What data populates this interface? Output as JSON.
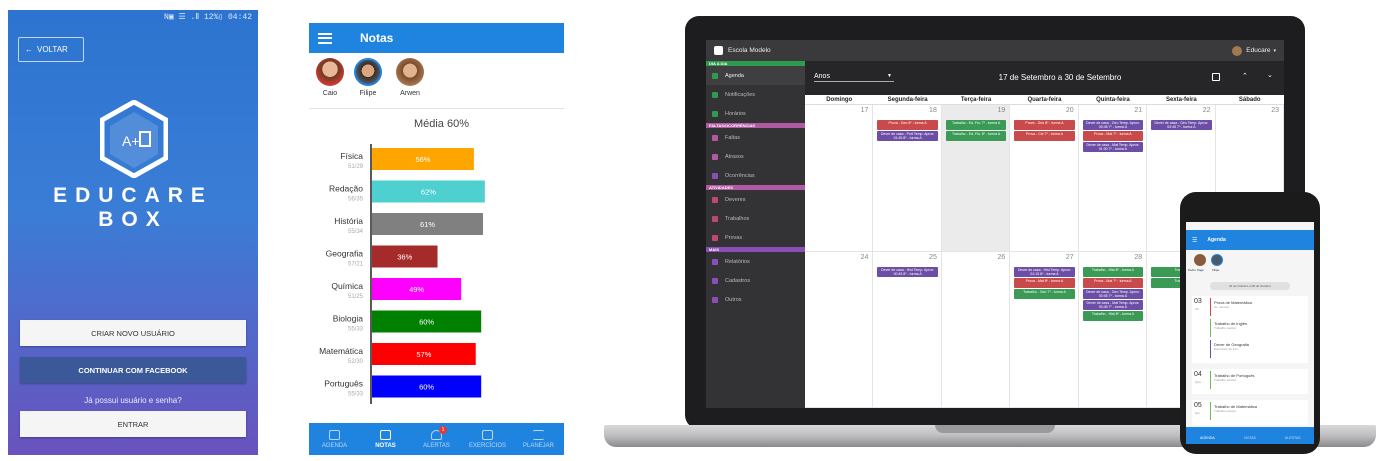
{
  "login": {
    "status": "N▣ ☰ .Ⅱ 12%▯ 04:42",
    "back_label": "VOLTAR",
    "brand_line1": "EDUCARE",
    "brand_line2": "BOX",
    "create_user": "CRIAR NOVO USUÁRIO",
    "facebook": "CONTINUAR COM FACEBOOK",
    "question": "Já possui usuário e senha?",
    "enter": "ENTRAR",
    "colors": {
      "facebook": "#3b5998"
    }
  },
  "grades": {
    "title": "Notas",
    "students": [
      "Caio",
      "Filipe",
      "Arwen"
    ],
    "average": "Média 60%",
    "nav": [
      "AGENDA",
      "NOTAS",
      "ALERTAS",
      "EXERCÍCIOS",
      "PLANEJAR"
    ],
    "alert_badge": "1",
    "chart_data": {
      "type": "bar",
      "orientation": "horizontal",
      "title": "Média 60%",
      "categories": [
        "Física",
        "Redação",
        "História",
        "Geografia",
        "Química",
        "Biologia",
        "Matemática",
        "Português"
      ],
      "sublabels": [
        "51/29",
        "56/35",
        "55/34",
        "57/21",
        "51/25",
        "55/33",
        "52/30",
        "55/33"
      ],
      "values": [
        56,
        62,
        61,
        36,
        49,
        60,
        57,
        60
      ],
      "value_labels": [
        "56%",
        "62%",
        "61%",
        "36%",
        "49%",
        "60%",
        "57%",
        "60%"
      ],
      "colors": [
        "#ffa500",
        "#4ecfd0",
        "#808080",
        "#a52a2a",
        "#ff00ff",
        "#008000",
        "#ff0000",
        "#0000ff"
      ],
      "xlim": [
        0,
        100
      ]
    }
  },
  "laptop": {
    "school": "Escola Modelo",
    "user": "Educare",
    "view_select": "Anos",
    "range": "17 de Setembro a 30 de Setembro",
    "sections": [
      {
        "label": "DIA A DIA",
        "color": "#2e9b4f",
        "items": [
          "Agenda",
          "Notificações",
          "Horários"
        ]
      },
      {
        "label": "FALTAS/OCORRÊNCIAS",
        "color": "#b05aa3",
        "items": [
          "Faltas",
          "Atrasos",
          "Ocorrências"
        ]
      },
      {
        "label": "ATIVIDADES",
        "color": "#b05aa3",
        "items": [
          "Deveres",
          "Trabalhos",
          "Provas"
        ]
      },
      {
        "label": "MAIS",
        "color": "#8a4fb5",
        "items": [
          "Relatórios",
          "Cadastros",
          "Outros"
        ]
      }
    ],
    "weekdays": [
      "Domingo",
      "Segunda-feira",
      "Terça-feira",
      "Quarta-feira",
      "Quinta-feira",
      "Sexta-feira",
      "Sábado"
    ],
    "week1": [
      "17",
      "18",
      "19",
      "20",
      "21",
      "22",
      "23"
    ],
    "week2": [
      "24",
      "25",
      "26",
      "27",
      "28",
      "29",
      "30"
    ],
    "events": [
      {
        "day": 1,
        "week": 0,
        "slot": 0,
        "color": "#c94a4a",
        "text": "Prova - Geo 8º - turma A"
      },
      {
        "day": 1,
        "week": 0,
        "slot": 1,
        "color": "#6d4ea6",
        "text": "Dever de casa - Port Temp. Aprox: 01:45 8º - turma A"
      },
      {
        "day": 2,
        "week": 0,
        "slot": 0,
        "color": "#3c9a57",
        "text": "Trabalho - Ed. Fís. 7º - turma A"
      },
      {
        "day": 2,
        "week": 0,
        "slot": 1,
        "color": "#3c9a57",
        "text": "Trabalho - Ed. Fís. 8º - turma A"
      },
      {
        "day": 3,
        "week": 0,
        "slot": 0,
        "color": "#c94a4a",
        "text": "Prova - Geo 8º - turma A"
      },
      {
        "day": 3,
        "week": 0,
        "slot": 1,
        "color": "#c94a4a",
        "text": "Prova - Cie 7º - turma A"
      },
      {
        "day": 4,
        "week": 0,
        "slot": 0,
        "color": "#6d4ea6",
        "text": "Dever de casa - Geo Temp. Aprox: 00:45 7º - turma A"
      },
      {
        "day": 4,
        "week": 0,
        "slot": 1,
        "color": "#c94a4a",
        "text": "Prova - Mat 7º - turma A"
      },
      {
        "day": 4,
        "week": 0,
        "slot": 2,
        "color": "#6d4ea6",
        "text": "Dever de casa - Mat Temp. Aprox: 01:00 7º - turma A"
      },
      {
        "day": 5,
        "week": 0,
        "slot": 0,
        "color": "#6d4ea6",
        "text": "Dever de casa - Geo Temp. Aprox: 00:45 7º - turma A"
      },
      {
        "day": 1,
        "week": 1,
        "slot": 0,
        "color": "#6d4ea6",
        "text": "Dever de casa - Hist Temp. Aprox: 00:45 8º - turma A"
      },
      {
        "day": 3,
        "week": 1,
        "slot": 0,
        "color": "#6d4ea6",
        "text": "Dever de casa - Hist Temp. Aprox: 01:15 8º - turma A"
      },
      {
        "day": 3,
        "week": 1,
        "slot": 1,
        "color": "#c94a4a",
        "text": "Prova - Mat 8º - turma A"
      },
      {
        "day": 3,
        "week": 1,
        "slot": 2,
        "color": "#3c9a57",
        "text": "Trabalho - Geo 7º - turma A"
      },
      {
        "day": 4,
        "week": 1,
        "slot": 0,
        "color": "#3c9a57",
        "text": "Trabalho - Hist 8º - turma A"
      },
      {
        "day": 4,
        "week": 1,
        "slot": 1,
        "color": "#c94a4a",
        "text": "Prova - Mat 7º - turma A"
      },
      {
        "day": 4,
        "week": 1,
        "slot": 2,
        "color": "#6d4ea6",
        "text": "Dever de casa - Geo Temp. Aprox: 00:45 7º - turma A"
      },
      {
        "day": 4,
        "week": 1,
        "slot": 3,
        "color": "#6d4ea6",
        "text": "Dever de casa - Mat Temp. Aprox: 00:45 7º - turma A"
      },
      {
        "day": 4,
        "week": 1,
        "slot": 4,
        "color": "#3c9a57",
        "text": "Trabalho - Hist 8º - turma A"
      },
      {
        "day": 5,
        "week": 1,
        "slot": 0,
        "color": "#3c9a57",
        "text": "Trabalho"
      },
      {
        "day": 5,
        "week": 1,
        "slot": 1,
        "color": "#3c9a57",
        "text": "Trabalho"
      }
    ]
  },
  "mobile": {
    "title": "Agenda",
    "students": [
      "Pedro Pagé",
      "Filipe"
    ],
    "range": "01 de Outubro a 08 de Outubro",
    "days": [
      {
        "num": "03",
        "wd": "Ter",
        "items": [
          {
            "t": "Prova de Matemática",
            "s": "Av. mensal",
            "c": "#c94a4a"
          },
          {
            "t": "Trabalho de Inglês",
            "s": "Trabalho parcial",
            "c": "#6fbd4a"
          },
          {
            "t": "Dever de Geografia",
            "s": "Exercícios do livro",
            "c": "#6d4ea6"
          }
        ]
      },
      {
        "num": "04",
        "wd": "Qua",
        "items": [
          {
            "t": "Trabalho de Português",
            "s": "Trabalho parcial",
            "c": "#6fbd4a"
          }
        ]
      },
      {
        "num": "05",
        "wd": "Qui",
        "items": [
          {
            "t": "Trabalho de Matemática",
            "s": "Trabalho parcial",
            "c": "#6fbd4a"
          }
        ]
      }
    ],
    "nav": [
      "AGENDA",
      "NOTAS",
      "ALERTAS"
    ]
  }
}
